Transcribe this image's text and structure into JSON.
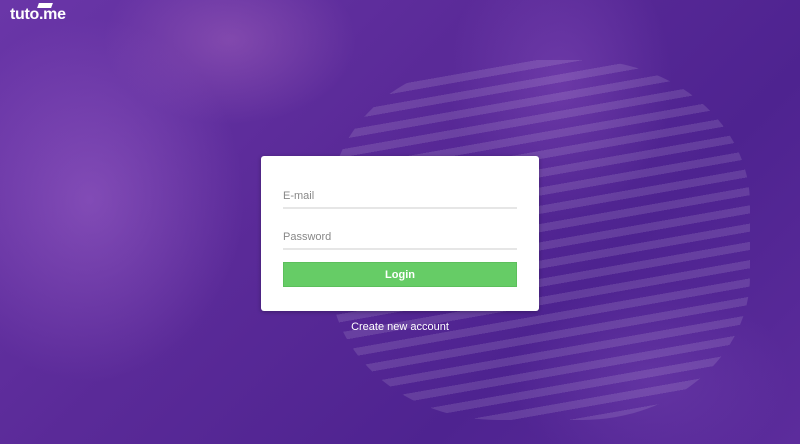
{
  "brand": {
    "name": "tuto.me",
    "icon": "graduation-cap-icon"
  },
  "login_form": {
    "email_placeholder": "E-mail",
    "email_value": "",
    "password_placeholder": "Password",
    "password_value": "",
    "login_label": "Login"
  },
  "create_account_label": "Create new account",
  "colors": {
    "accent": "#66cc66",
    "background": "#5a2a98"
  }
}
